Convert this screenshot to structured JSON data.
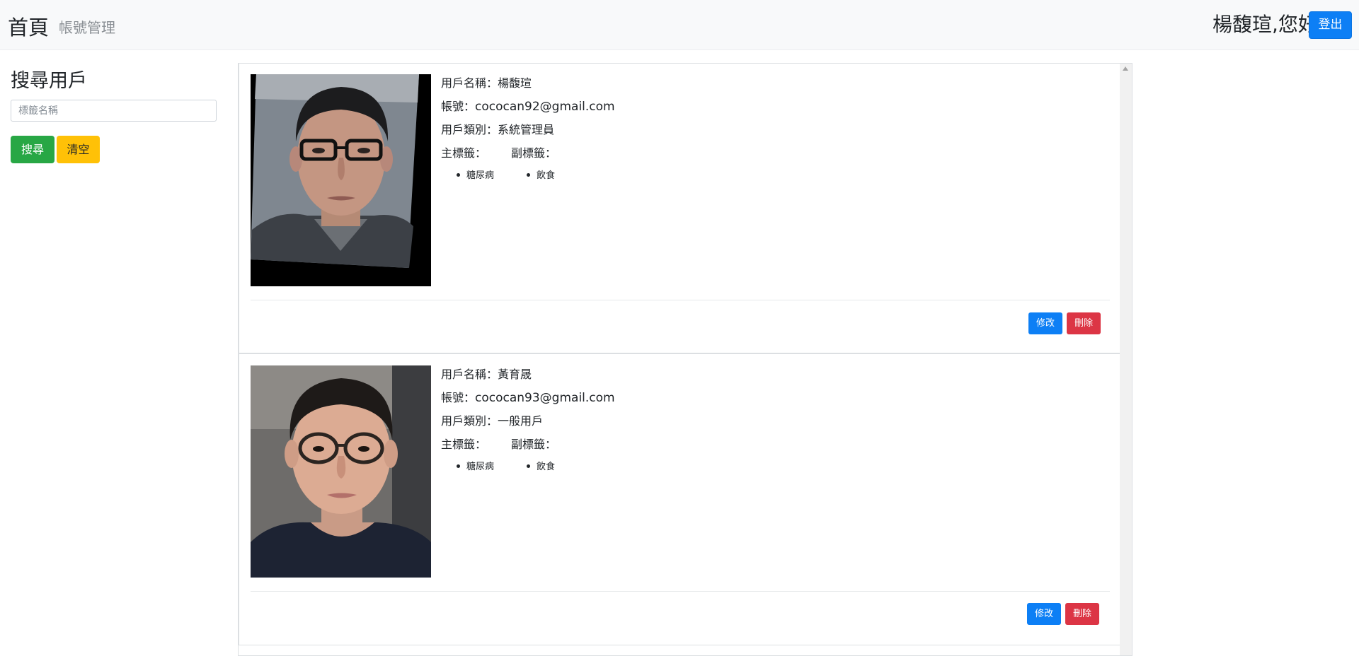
{
  "navbar": {
    "brand": "首頁",
    "link_account": "帳號管理",
    "greeting": "楊馥瑄,您好",
    "logout": "登出"
  },
  "sidebar": {
    "title": "搜尋用戶",
    "search_placeholder": "標籤名稱",
    "search_button": "搜尋",
    "clear_button": "清空"
  },
  "labels": {
    "username": "用戶名稱：",
    "account": "帳號：",
    "category": "用戶類別：",
    "main_tag": "主標籤：",
    "sub_tag": "副標籤：",
    "edit": "修改",
    "delete": "刪除"
  },
  "users": [
    {
      "name": "楊馥瑄",
      "email": "cococan92@gmail.com",
      "category": "系統管理員",
      "main_tags": [
        "糖尿病"
      ],
      "sub_tags": [
        "飲食"
      ]
    },
    {
      "name": "黃育晟",
      "email": "cococan93@gmail.com",
      "category": "一般用戶",
      "main_tags": [
        "糖尿病"
      ],
      "sub_tags": [
        "飲食"
      ]
    }
  ],
  "colors": {
    "primary": "#0d7ff5",
    "success": "#28a745",
    "warning": "#ffc107",
    "danger": "#dc3545"
  }
}
